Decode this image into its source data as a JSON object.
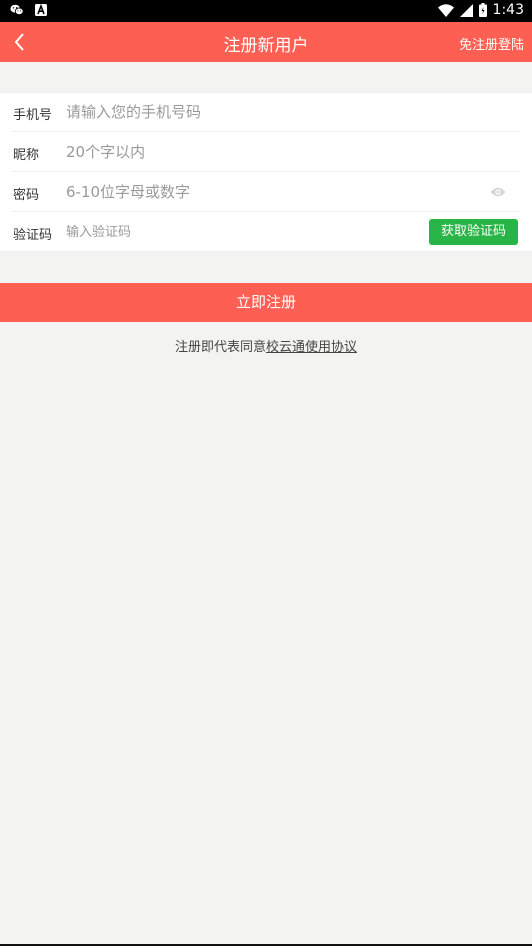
{
  "status_bar": {
    "time": "1:43",
    "left_icons": [
      "wechat-icon",
      "notification-a-icon"
    ],
    "right_icons": [
      "wifi-icon",
      "signal-icon",
      "battery-icon"
    ]
  },
  "app_bar": {
    "title": "注册新用户",
    "action_label": "免注册登陆",
    "background_color": "#fd5f52"
  },
  "form": {
    "phone": {
      "label": "手机号",
      "placeholder": "请输入您的手机号码",
      "value": ""
    },
    "nickname": {
      "label": "昵称",
      "placeholder": "20个字以内",
      "value": ""
    },
    "password": {
      "label": "密码",
      "placeholder": "6-10位字母或数字",
      "value": "",
      "toggle_icon": "eye-icon"
    },
    "code": {
      "label": "验证码",
      "placeholder": "输入验证码",
      "value": "",
      "button_label": "获取验证码",
      "button_color": "#28b446"
    }
  },
  "submit": {
    "label": "立即注册"
  },
  "agreement": {
    "prefix": "注册即代表同意",
    "link": "校云通使用协议"
  }
}
